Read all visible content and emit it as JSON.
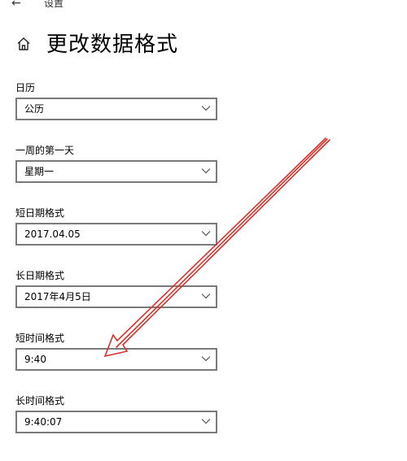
{
  "header": {
    "back_icon": "←",
    "window_title": "设置"
  },
  "page": {
    "title": "更改数据格式"
  },
  "fields": [
    {
      "label": "日历",
      "value": "公历"
    },
    {
      "label": "一周的第一天",
      "value": "星期一"
    },
    {
      "label": "短日期格式",
      "value": "2017.04.05"
    },
    {
      "label": "长日期格式",
      "value": "2017年4月5日"
    },
    {
      "label": "短时间格式",
      "value": "9:40"
    },
    {
      "label": "长时间格式",
      "value": "9:40:07"
    }
  ],
  "annotation": {
    "arrow_color": "#d9312b"
  }
}
